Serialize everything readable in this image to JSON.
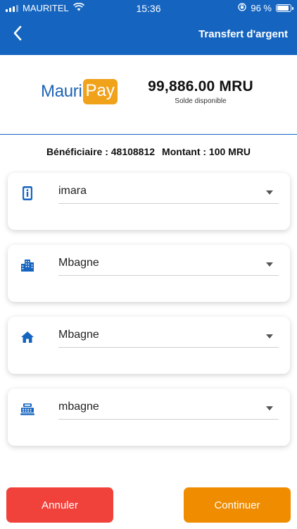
{
  "status_bar": {
    "carrier": "MAURITEL",
    "time": "15:36",
    "battery": "96 %"
  },
  "header": {
    "title": "Transfert d'argent"
  },
  "logo": {
    "part1": "Mauri",
    "part2": "Pay"
  },
  "balance": {
    "amount": "99,886.00 MRU",
    "label": "Solde disponible"
  },
  "summary": {
    "beneficiary": "Bénéficiaire : 48108812",
    "amount": "Montant : 100 MRU"
  },
  "fields": [
    {
      "icon": "id-card-icon",
      "value": "imara"
    },
    {
      "icon": "city-buildings-icon",
      "value": "Mbagne"
    },
    {
      "icon": "home-icon",
      "value": "Mbagne"
    },
    {
      "icon": "cash-register-icon",
      "value": "mbagne"
    }
  ],
  "buttons": {
    "cancel": "Annuler",
    "continue": "Continuer"
  },
  "colors": {
    "primary": "#1565c0",
    "accent": "#f08c00",
    "danger": "#f1413b",
    "logo_blue": "#1e63b5",
    "logo_orange": "#f0a21b"
  }
}
